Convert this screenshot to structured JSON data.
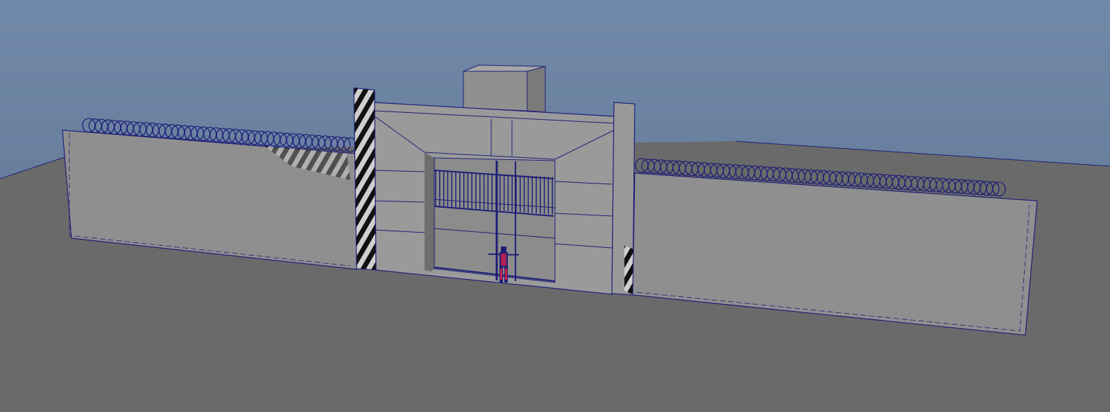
{
  "viewport": {
    "colors": {
      "sky_top": "#7189a8",
      "sky_bottom": "#5c7090",
      "ground": "#6a6a6a",
      "wall": "#8f8f8f",
      "block": "#999999",
      "block_dark": "#777777",
      "wire": "#1e1e78",
      "figure": "#d0204a"
    }
  }
}
